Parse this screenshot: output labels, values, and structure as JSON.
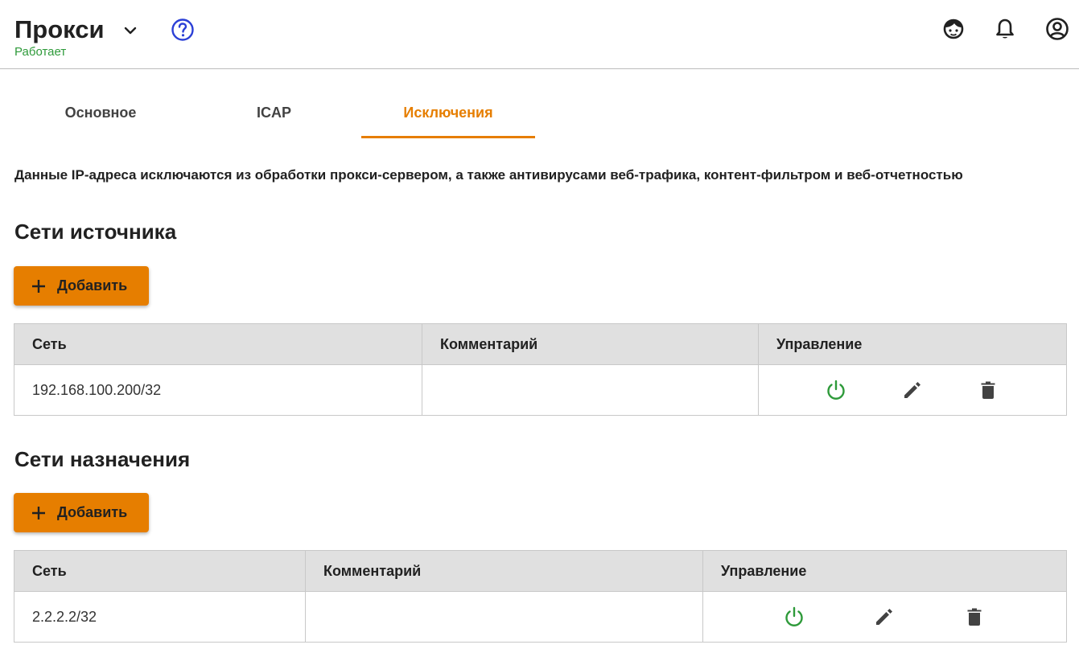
{
  "header": {
    "title": "Прокси",
    "status": "Работает",
    "status_color": "#2e9a3a",
    "icons": [
      "chevron-down-icon",
      "help-icon",
      "support-icon",
      "bell-icon",
      "account-icon"
    ]
  },
  "tabs": [
    {
      "label": "Основное",
      "active": false
    },
    {
      "label": "ICAP",
      "active": false
    },
    {
      "label": "Исключения",
      "active": true
    }
  ],
  "accent_color": "#e67e00",
  "info_text": "Данные IP-адреса исключаются из обработки прокси-сервером, а также антивирусами веб-трафика, контент-фильтром и веб-отчетностью",
  "source": {
    "title": "Сети источника",
    "add_label": "Добавить",
    "columns": [
      "Сеть",
      "Комментарий",
      "Управление"
    ],
    "rows": [
      {
        "network": "192.168.100.200/32",
        "comment": ""
      }
    ]
  },
  "destination": {
    "title": "Сети назначения",
    "add_label": "Добавить",
    "columns": [
      "Сеть",
      "Комментарий",
      "Управление"
    ],
    "rows": [
      {
        "network": "2.2.2.2/32",
        "comment": ""
      }
    ]
  },
  "row_controls": [
    "power-icon",
    "edit-icon",
    "delete-icon"
  ],
  "power_color": "#2e9a3a"
}
